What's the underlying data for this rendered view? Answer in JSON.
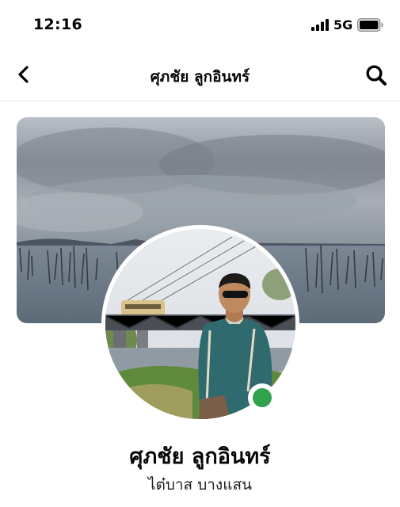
{
  "status_bar": {
    "time": "12:16",
    "network": "5G"
  },
  "nav": {
    "title": "ศุภชัย ลูกอินทร์",
    "back_icon": "chevron-left-icon",
    "search_icon": "search-icon"
  },
  "profile": {
    "name": "ศุภชัย ลูกอินทร์",
    "location": "ไต๋บาส บางแสน",
    "online": true,
    "online_color": "#31a24c"
  }
}
